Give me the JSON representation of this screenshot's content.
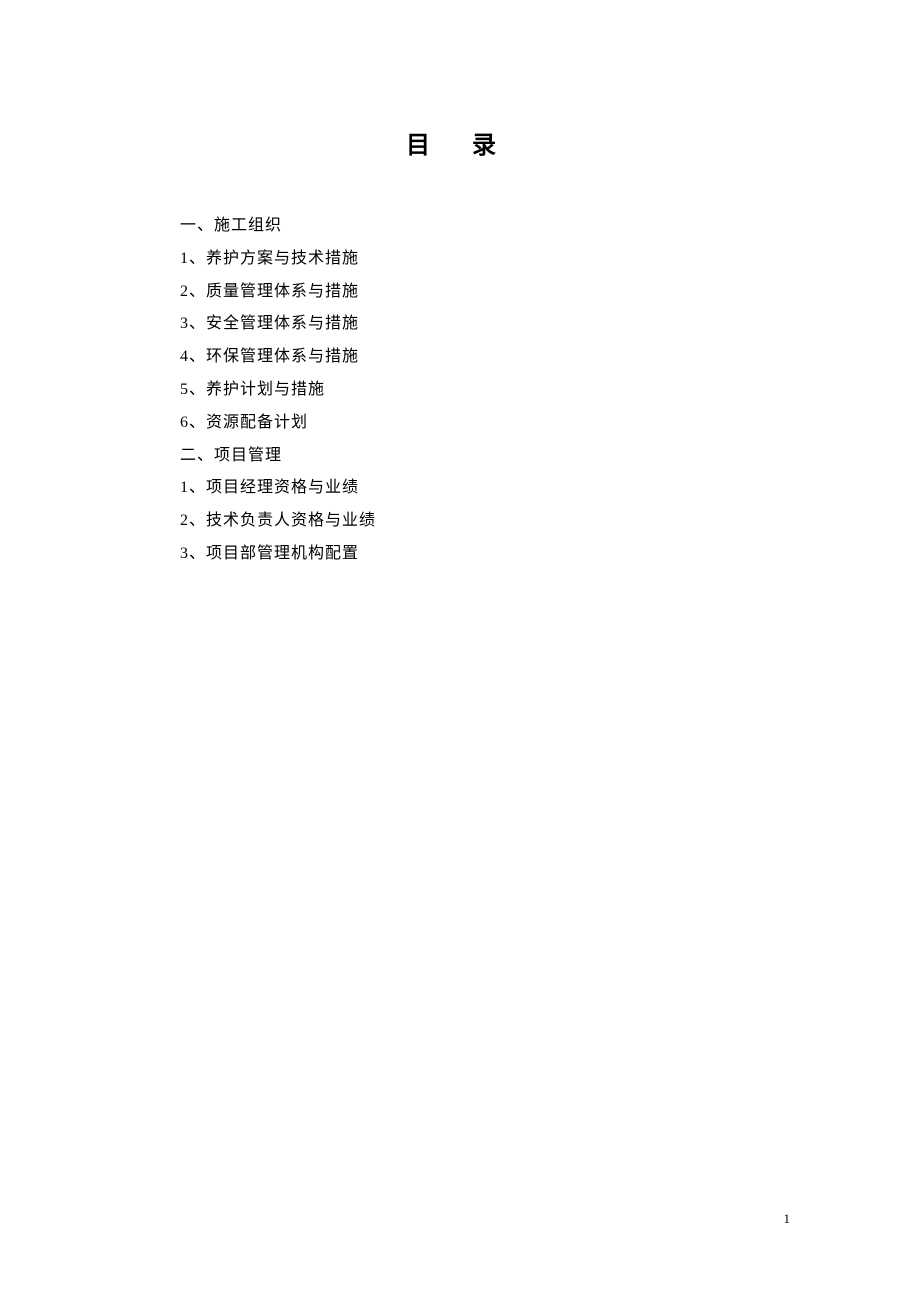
{
  "title": "目 录",
  "toc": [
    "一、施工组织",
    "1、养护方案与技术措施",
    "2、质量管理体系与措施",
    "3、安全管理体系与措施",
    "4、环保管理体系与措施",
    "5、养护计划与措施",
    "6、资源配备计划",
    "二、项目管理",
    "1、项目经理资格与业绩",
    "2、技术负责人资格与业绩",
    "3、项目部管理机构配置"
  ],
  "page_number": "1"
}
